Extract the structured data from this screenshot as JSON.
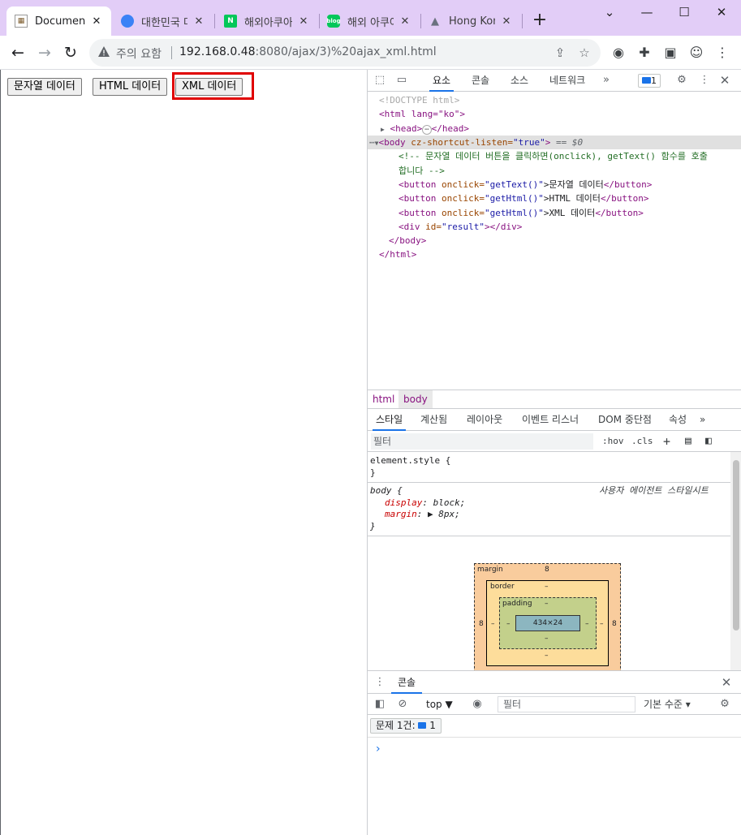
{
  "tabs": [
    {
      "label": "Document",
      "close": "✕",
      "favicon_color": "#ffffff",
      "favicon_text": "▦"
    },
    {
      "label": "대한민국 다",
      "close": "✕",
      "favicon_color": "#3b82f6",
      "favicon_text": "◉"
    },
    {
      "label": "해외아쿠아",
      "close": "✕",
      "favicon_color": "#03c75a",
      "favicon_text": "N"
    },
    {
      "label": "해외 아쿠아",
      "close": "✕",
      "favicon_color": "#03c75a",
      "favicon_text": "b"
    },
    {
      "label": "Hong Kong",
      "close": "✕",
      "favicon_color": "#8b8b8b",
      "favicon_text": "▲"
    }
  ],
  "new_tab": "+",
  "window_controls": {
    "collapse": "⌄",
    "minimize": "—",
    "maximize": "☐",
    "close": "✕"
  },
  "toolbar": {
    "back": "←",
    "forward": "→",
    "reload": "↻",
    "security_label": "주의 요함",
    "url_host": "192.168.0.48",
    "url_rest": ":8080/ajax/3)%20ajax_xml.html",
    "share": "⇪",
    "bookmark": "☆",
    "camera": "◉",
    "extensions": "✚",
    "sidepanel": "▣",
    "profile": "☺",
    "menu": "⋮"
  },
  "page": {
    "buttons": [
      "문자열 데이터",
      "HTML 데이터",
      "XML 데이터"
    ]
  },
  "devtools": {
    "tabs": [
      "요소",
      "콘솔",
      "소스",
      "네트워크"
    ],
    "more_tabs": "»",
    "issues_count": "1",
    "settings": "⚙",
    "more": "⋮",
    "close": "✕",
    "inspect": "⬚",
    "device": "▭",
    "dom": {
      "doctype": "<!DOCTYPE html>",
      "html_open": "<html lang=\"ko\">",
      "head_line": "<head>",
      "head_ellipsis": "⋯",
      "head_close": "</head>",
      "body_tag": "<body",
      "body_attr": " cz-shortcut-listen=",
      "body_val": "\"true\"",
      "body_end": ">",
      "body_eq": " == $0",
      "comment_1": "<!-- 문자열 데이터 버튼을 클릭하면(onclick), getText() 함수를 호출",
      "comment_2": "합니다 -->",
      "btn1_open": "<button",
      "btn1_attr": " onclick=",
      "btn1_val": "\"getText()\"",
      "btn1_text": ">문자열 데이터",
      "btn1_close": "</button>",
      "btn2_val": "\"getHtml()\"",
      "btn2_text": ">HTML 데이터",
      "btn3_val": "\"getHtml()\"",
      "btn3_text": ">XML 데이터",
      "div_open": "<div",
      "div_attr": " id=",
      "div_val": "\"result\"",
      "div_close": "></div>",
      "body_close": "</body>",
      "html_close": "</html>"
    },
    "breadcrumbs": [
      "html",
      "body"
    ],
    "styles_tabs": [
      "스타일",
      "계산됨",
      "레이아웃",
      "이벤트 리스너",
      "DOM 중단점",
      "속성"
    ],
    "filter_placeholder": "필터",
    "hov": ":hov",
    "cls": ".cls",
    "rules": {
      "element_style": "element.style {",
      "element_close": "}",
      "body_selector": "body {",
      "ua_label": "사용자 에이전트 스타일시트",
      "display_name": "display",
      "display_value": ": block;",
      "margin_name": "margin",
      "margin_value": ": ▶ 8px;",
      "body_close": "}"
    },
    "box_model": {
      "margin_label": "margin",
      "margin_top": "8",
      "margin_left": "8",
      "margin_right": "8",
      "margin_bottom": "8",
      "border_label": "border",
      "border_value": "–",
      "padding_label": "padding",
      "padding_value": "–",
      "content": "434×24"
    },
    "console": {
      "tab": "콘솔",
      "context": "top ▼",
      "filter_placeholder": "필터",
      "level": "기본 수준 ▾",
      "issues_label": "문제 1건:",
      "issues_count": "1",
      "prompt": "›"
    }
  }
}
